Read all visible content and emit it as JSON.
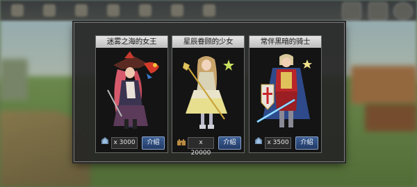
{
  "cards": [
    {
      "title": "迷雾之海的女王",
      "cost": "x 3000",
      "button": "介绍",
      "currency_icon": "crystal-icon"
    },
    {
      "title": "星辰眷顾的少女",
      "cost": "x 20000",
      "button": "介绍",
      "currency_icon": "castle-icon"
    },
    {
      "title": "常伴黑暗的骑士",
      "cost": "x 3500",
      "button": "介绍",
      "currency_icon": "crystal-icon"
    }
  ],
  "colors": {
    "card_title_bg": "#d8d8d8",
    "info_button": "#2e4c80",
    "dialog_bg": "#262626"
  }
}
